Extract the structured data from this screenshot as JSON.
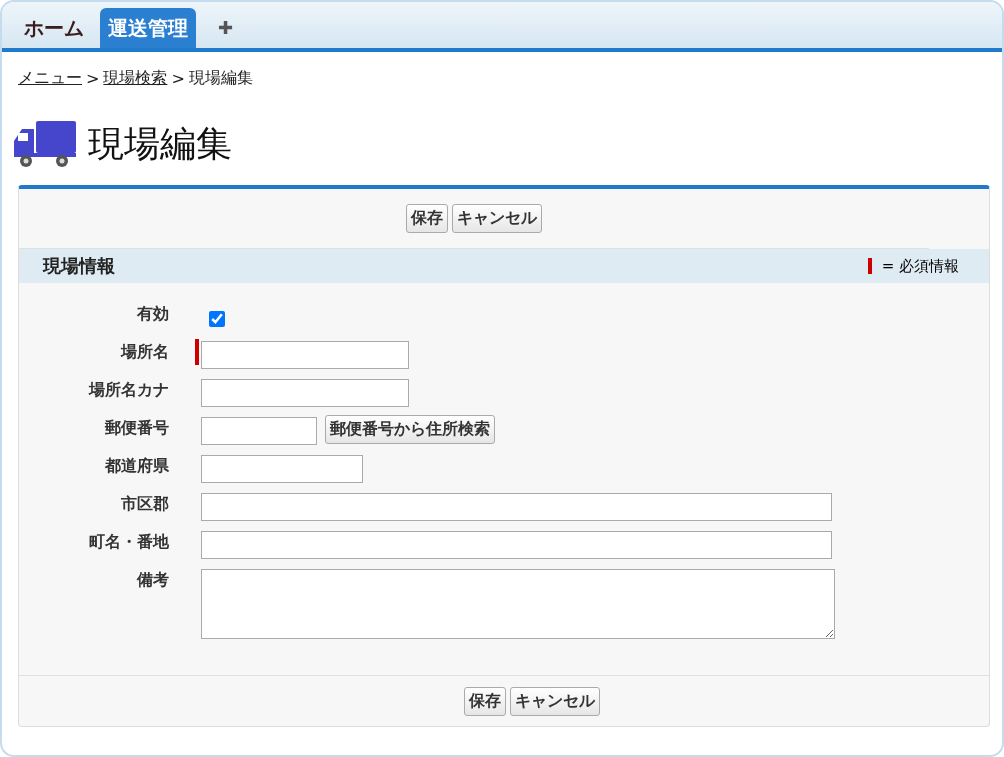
{
  "tabs": [
    {
      "label": "ホーム",
      "kind": "tab",
      "selected": false
    },
    {
      "label": "運送管理",
      "kind": "tab",
      "selected": true
    },
    {
      "label": "✚",
      "kind": "add"
    }
  ],
  "breadcrumb": [
    {
      "label": "メニュー",
      "link": true
    },
    {
      "label": "現場検索",
      "link": true
    },
    {
      "label": "現場編集",
      "link": false
    }
  ],
  "breadcrumb_separator": ">",
  "page_title": "現場編集",
  "top_buttons": [
    "保存",
    "キャンセル"
  ],
  "bottom_buttons": [
    "保存",
    "キャンセル"
  ],
  "section": {
    "title": "現場情報",
    "required_legend": "= 必須情報"
  },
  "fields": [
    {
      "label": "有効",
      "kind": "checkbox",
      "checked": true,
      "required": false
    },
    {
      "label": "場所名",
      "kind": "text",
      "required": true
    },
    {
      "label": "場所名カナ",
      "kind": "text",
      "required": false
    },
    {
      "label": "郵便番号",
      "kind": "text",
      "required": false,
      "button": "郵便番号から住所検索"
    },
    {
      "label": "都道府県",
      "kind": "text",
      "required": false
    },
    {
      "label": "市区郡",
      "kind": "text",
      "required": false
    },
    {
      "label": "町名・番地",
      "kind": "text",
      "required": false
    },
    {
      "label": "備考",
      "kind": "textarea",
      "required": false
    }
  ]
}
